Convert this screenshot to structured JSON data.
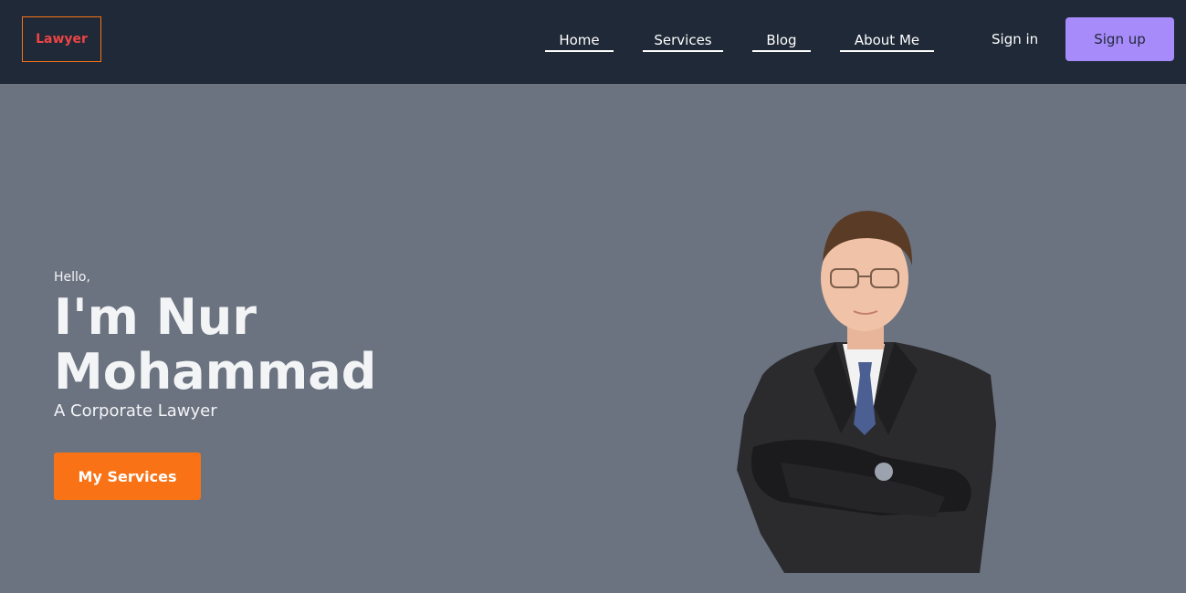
{
  "nav": {
    "logo": "Lawyer",
    "links": [
      {
        "label": "Home"
      },
      {
        "label": "Services"
      },
      {
        "label": "Blog"
      },
      {
        "label": "About Me"
      }
    ],
    "sign_in": "Sign in",
    "sign_up": "Sign up"
  },
  "hero": {
    "greeting": "Hello,",
    "name": "I'm Nur Mohammad",
    "subtitle": "A Corporate Lawyer",
    "cta_label": "My Services"
  },
  "colors": {
    "nav_bg": "#1f2937",
    "hero_bg": "#6b7280",
    "logo_text": "#ef4444",
    "logo_border": "#f97316",
    "sign_up_bg": "#a78bfa",
    "cta_bg": "#f97316"
  }
}
